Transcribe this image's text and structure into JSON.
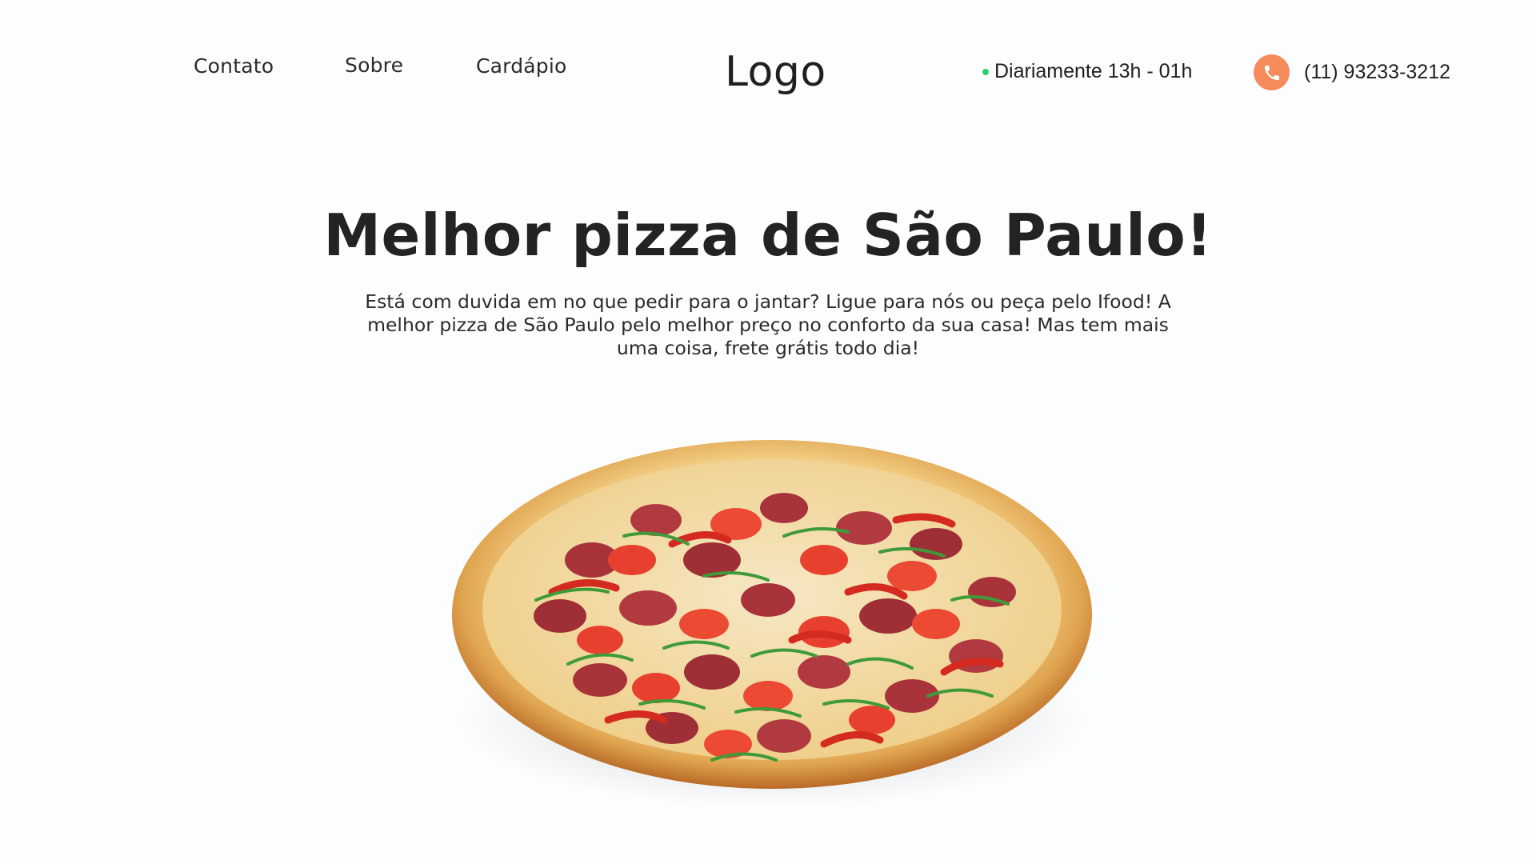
{
  "nav": {
    "items": [
      {
        "label": "Contato"
      },
      {
        "label": "Sobre"
      },
      {
        "label": "Cardápio"
      }
    ]
  },
  "brand": {
    "logo_text": "Logo"
  },
  "contact": {
    "hours": "Diariamente 13h - 01h",
    "phone": "(11) 93233-3212",
    "status_icon": "status-dot",
    "phone_icon": "phone-icon"
  },
  "hero": {
    "title": "Melhor pizza de São Paulo!",
    "description": "Está com duvida em no que pedir para o jantar? Ligue para nós ou peça pelo Ifood! A melhor pizza de São Paulo pelo melhor preço no conforto da sua casa! Mas tem mais uma coisa, frete grátis todo dia!"
  },
  "colors": {
    "background": "#fcfdfe",
    "status_dot": "#2ecc71",
    "phone_accent": "#f58a5b",
    "text": "#222222"
  }
}
